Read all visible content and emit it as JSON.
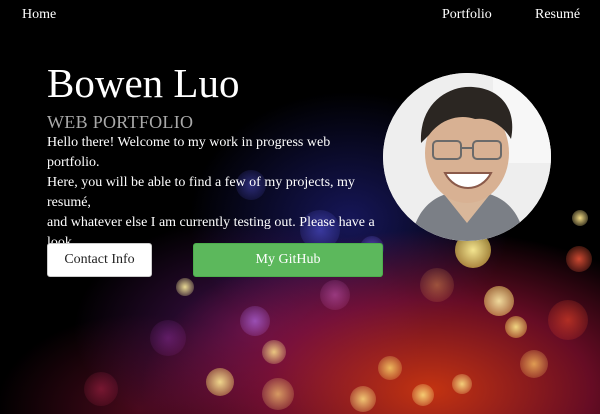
{
  "nav": {
    "home": "Home",
    "portfolio": "Portfolio",
    "resume": "Resumé"
  },
  "hero": {
    "name": "Bowen Luo",
    "subtitle": "WEB PORTFOLIO",
    "intro": "Hello there! Welcome to my work in progress web portfolio.\nHere, you will be able to find a few of my projects, my resumé,\nand whatever else I am currently testing out. Please have a look\naround!"
  },
  "buttons": {
    "contact": "Contact Info",
    "github": "My GitHub"
  },
  "colors": {
    "github_button": "#5cb85c",
    "subtitle": "#a9a9a9",
    "background": "#000000"
  },
  "icons": {
    "avatar": "profile-photo"
  }
}
